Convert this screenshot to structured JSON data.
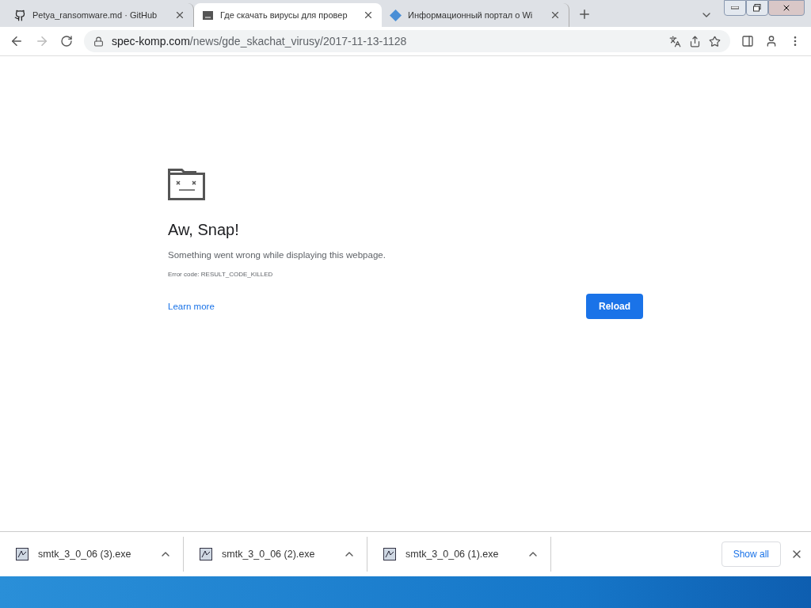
{
  "tabs": [
    {
      "title": "Petya_ransomware.md · GitHub",
      "kind": "github",
      "selected": false
    },
    {
      "title": "Где скачать вирусы для провер",
      "kind": "sad",
      "selected": true
    },
    {
      "title": "Информационный портал о Wi",
      "kind": "diamond",
      "selected": false
    }
  ],
  "address": {
    "url_host": "spec-komp.com",
    "url_path": "/news/gde_skachat_virusy/2017-11-13-1128"
  },
  "error": {
    "title": "Aw, Snap!",
    "message": "Something went wrong while displaying this webpage.",
    "code": "Error code: RESULT_CODE_KILLED",
    "link": "Learn more",
    "button": "Reload"
  },
  "downloads": [
    {
      "name": "smtk_3_0_06 (3).exe"
    },
    {
      "name": "smtk_3_0_06 (2).exe"
    },
    {
      "name": "smtk_3_0_06 (1).exe"
    }
  ],
  "show_all": "Show all"
}
